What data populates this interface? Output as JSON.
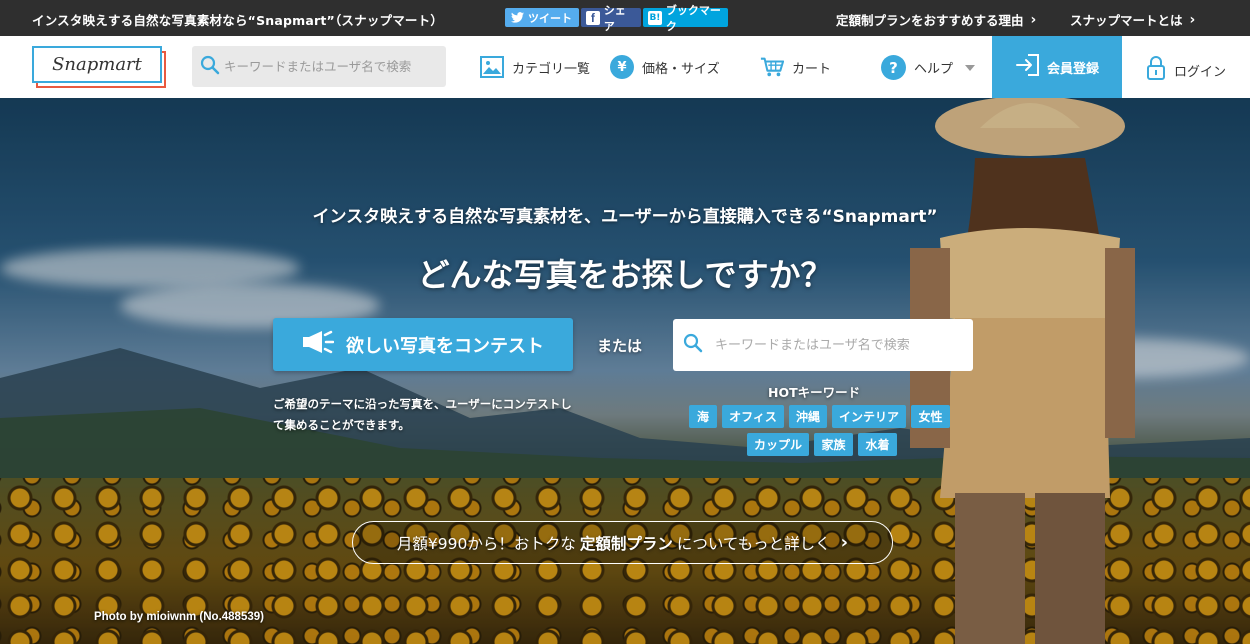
{
  "topbar": {
    "tagline": "インスタ映えする自然な写真素材なら“Snapmart”（スナップマート）",
    "share_buttons": [
      {
        "label": "ツイート",
        "icon": "twitter-bird-icon",
        "color": "#55acee"
      },
      {
        "label": "シェア",
        "icon": "facebook-icon",
        "color": "#3b5998"
      },
      {
        "label": "ブックマーク",
        "icon": "hatena-bookmark-icon",
        "icon_text": "B!",
        "color": "#00a4de"
      }
    ],
    "links": [
      {
        "label": "定額制プランをおすすめする理由"
      },
      {
        "label": "スナップマートとは"
      }
    ]
  },
  "header": {
    "logo_text": "Snapmart",
    "search_placeholder": "キーワードまたはユーザ名で検索",
    "nav": {
      "categories": "カテゴリ一覧",
      "price": "価格・サイズ",
      "price_icon_text": "¥",
      "cart": "カート",
      "help": "ヘルプ",
      "help_icon_text": "?"
    },
    "register": "会員登録",
    "login": "ログイン"
  },
  "hero": {
    "tagline": "インスタ映えする自然な写真素材を、ユーザーから直接購入できる“Snapmart”",
    "title": "どんな写真をお探しですか？",
    "contest_button": "欲しい写真をコンテスト",
    "or_text": "または",
    "search_placeholder": "キーワードまたはユーザ名で検索",
    "contest_description": "ご希望のテーマに沿った写真を、ユーザーにコンテストして集めることができます。",
    "hot_keywords_label": "HOTキーワード",
    "hot_keywords": [
      "海",
      "オフィス",
      "沖縄",
      "インテリア",
      "女性",
      "カップル",
      "家族",
      "水着"
    ],
    "plan_banner": {
      "prefix": "月額¥990から！おトクな",
      "bold": "定額制プラン",
      "suffix": "についてもっと詳しく"
    },
    "photo_credit": "Photo by mioiwnm (No.488539)"
  },
  "colors": {
    "accent": "#3aa9dc",
    "topbar_bg": "#2f2f2f",
    "logo_back_border": "#e9593f"
  }
}
